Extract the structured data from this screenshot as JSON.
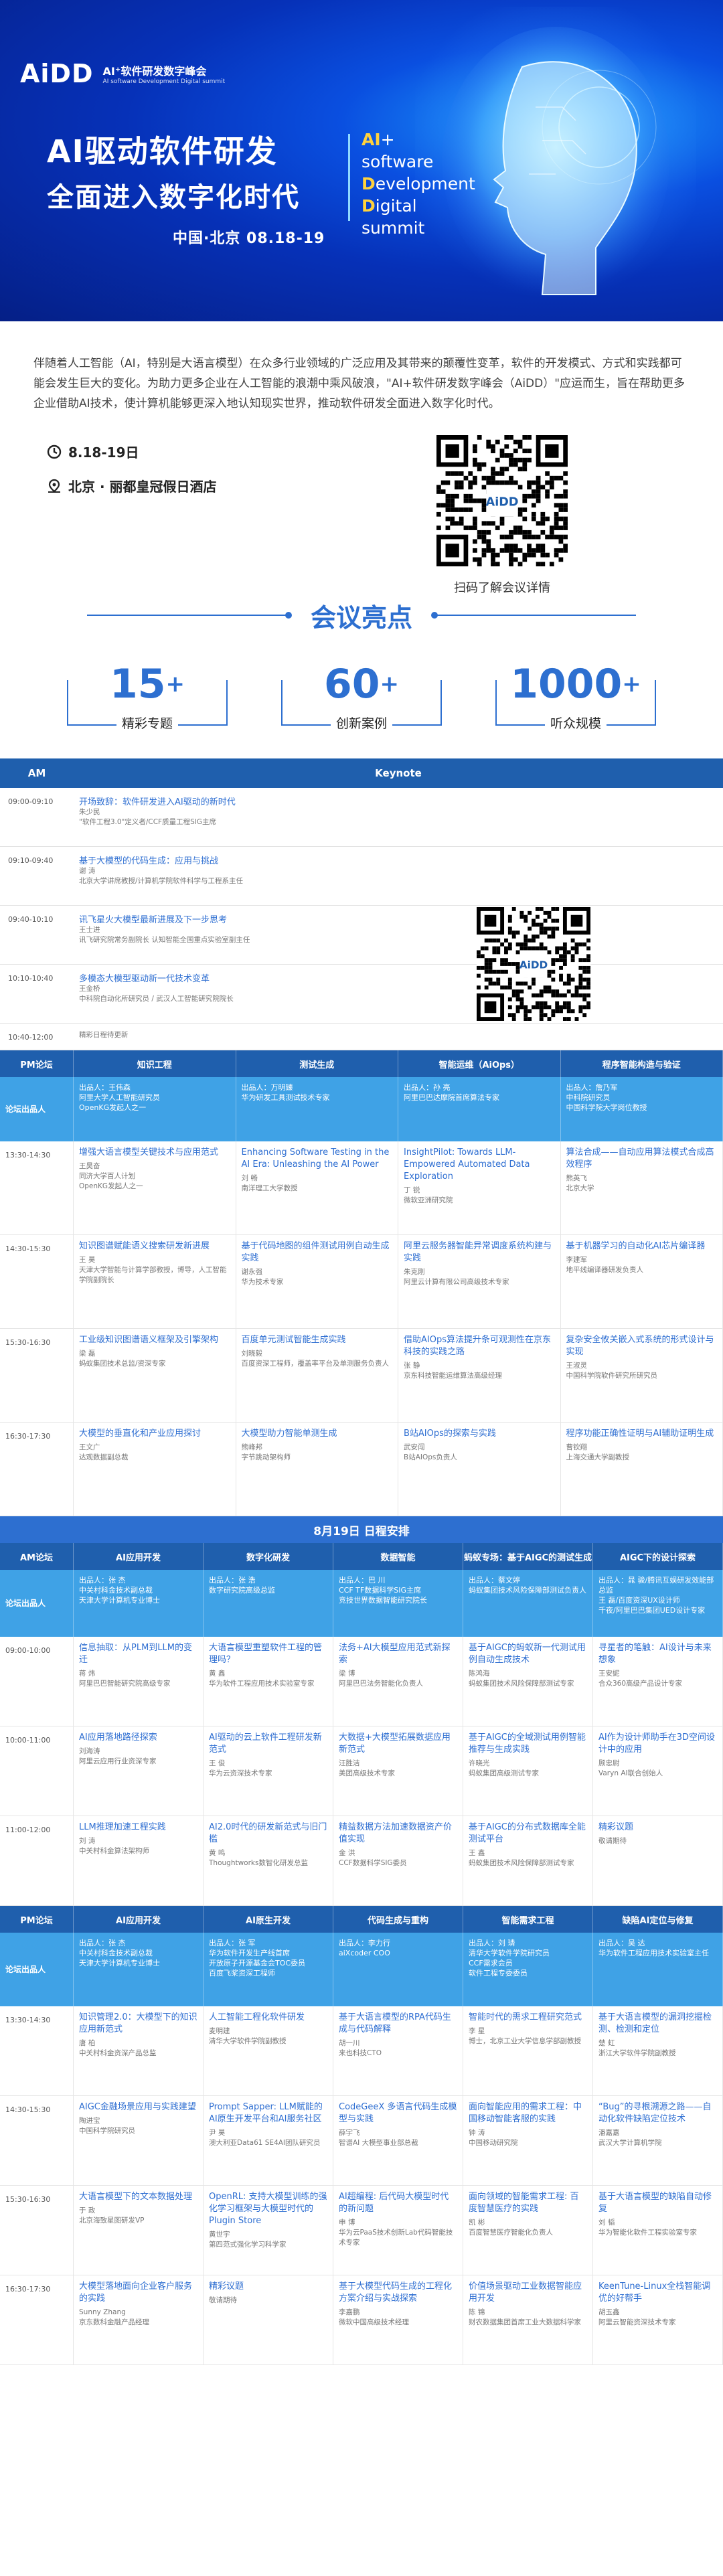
{
  "hero": {
    "logo_mark": "AiDD",
    "logo_line1": "AI⁺软件研发数字峰会",
    "logo_line2": "AI software Development Digital summit",
    "title_line1": "AI驱动软件研发",
    "title_line2": "全面进入数字化时代",
    "eng": [
      {
        "cap": "AI",
        "rest": "+"
      },
      {
        "cap": "",
        "rest": "software"
      },
      {
        "cap": "D",
        "rest": "evelopment"
      },
      {
        "cap": "D",
        "rest": "igital"
      },
      {
        "cap": "",
        "rest": "summit"
      }
    ],
    "date_line": "中国·北京 08.18-19"
  },
  "intro": {
    "text": "伴随着人工智能（AI，特别是大语言模型）在众多行业领域的广泛应用及其带来的颠覆性变革，软件的开发模式、方式和实践都可能会发生巨大的变化。为助力更多企业在人工智能的浪潮中乘风破浪，\"AI+软件研发数字峰会（AiDD）\"应运而生，旨在帮助更多企业借助AI技术，使计算机能够更深入地认知现实世界，推动软件研发全面进入数字化时代。",
    "date": "8.18-19日",
    "venue": "北京 · 丽都皇冠假日酒店",
    "qr_caption": "扫码了解会议详情"
  },
  "highlights": {
    "title": "会议亮点",
    "stats": [
      {
        "num": "15",
        "plus": "+",
        "label": "精彩专题"
      },
      {
        "num": "60",
        "plus": "+",
        "label": "创新案例"
      },
      {
        "num": "1000",
        "plus": "+",
        "label": "听众规模"
      }
    ]
  },
  "keynote": {
    "col1": "AM",
    "col2": "Keynote",
    "rows": [
      {
        "time": "09:00-09:10",
        "title": "开场致辞：软件研发进入AI驱动的新时代",
        "speaker": "朱少民",
        "desc": "\"软件工程3.0\"定义者/CCF质量工程SIG主席"
      },
      {
        "time": "09:10-09:40",
        "title": "基于大模型的代码生成：应用与挑战",
        "speaker": "谢 涛",
        "desc": "北京大学讲席教授/计算机学院软件科学与工程系主任"
      },
      {
        "time": "09:40-10:10",
        "title": "讯飞星火大模型最新进展及下一步思考",
        "speaker": "王士进",
        "desc": "讯飞研究院常务副院长 认知智能全国重点实验室副主任"
      },
      {
        "time": "10:10-10:40",
        "title": "多模态大模型驱动新一代技术变革",
        "speaker": "王金桥",
        "desc": "中科院自动化所研究员 / 武汉人工智能研究院院长"
      },
      {
        "time": "10:40-12:00",
        "title": "",
        "speaker": "",
        "desc": "精彩日程待更新"
      }
    ]
  },
  "day1pm": {
    "cols": [
      "PM论坛",
      "知识工程",
      "测试生成",
      "智能运维（AiOps）",
      "程序智能构造与验证"
    ],
    "chair_label": "论坛出品人",
    "chairs": [
      "出品人：王伟森\n阿里大学人工智能研究员\nOpenKG发起人之一",
      "出品人：万明臻\n华为研发工具测试技术专家",
      "出品人：孙 亮\n阿里巴巴达摩院首席算法专家",
      "出品人：詹乃军\n中科院研究员\n中国科学院大学岗位教授"
    ],
    "slots": [
      {
        "time": "13:30-14:30",
        "talks": [
          {
            "t": "增强大语言模型关键技术与应用范式",
            "s": "王昊奋\n同济大学百人计划\nOpenKG发起人之一"
          },
          {
            "t": "Enhancing Software Testing in the AI Era: Unleashing the AI Power",
            "s": "刘 畅\n南洋理工大学教授"
          },
          {
            "t": "InsightPilot: Towards LLM-Empowered Automated Data Exploration",
            "s": "丁 锐\n微软亚洲研究院"
          },
          {
            "t": "算法合成——自动应用算法模式合成高效程序",
            "s": "熊英飞\n北京大学"
          }
        ]
      },
      {
        "time": "14:30-15:30",
        "talks": [
          {
            "t": "知识图谱赋能语义搜索研发新进展",
            "s": "王 昊\n天津大学智能与计算学部教授，博导，人工智能学院副院长"
          },
          {
            "t": "基于代码地图的组件测试用例自动生成实践",
            "s": "谢永强\n华为技术专家"
          },
          {
            "t": "阿里云服务器智能异常调度系统构建与实践",
            "s": "朱克刚\n阿里云计算有限公司高级技术专家"
          },
          {
            "t": "基于机器学习的自动化AI芯片编译器",
            "s": "李建军\n地平线编译器研发负责人"
          }
        ]
      },
      {
        "time": "15:30-16:30",
        "talks": [
          {
            "t": "工业级知识图谱语义框架及引擎架构",
            "s": "梁 磊\n蚂蚁集团技术总监/资深专家"
          },
          {
            "t": "百度单元测试智能生成实践",
            "s": "刘晓毅\n百度资深工程师，覆盖率平台及单测服务负责人"
          },
          {
            "t": "借助AIOps算法提升条可观测性在京东科技的实践之路",
            "s": "张 静\n京东科技智能运维算法高级经理"
          },
          {
            "t": "复杂安全攸关嵌入式系统的形式设计与实现",
            "s": "王淑灵\n中国科学院软件研究所研究员"
          }
        ]
      },
      {
        "time": "16:30-17:30",
        "talks": [
          {
            "t": "大模型的垂直化和产业应用探讨",
            "s": "王文广\n达观数据副总裁"
          },
          {
            "t": "大模型助力智能单测生成",
            "s": "熊峰邦\n字节跳动架构师"
          },
          {
            "t": "B站AIOps的探索与实践",
            "s": "武安闯\nB站AIOps负责人"
          },
          {
            "t": "程序功能正确性证明与AI辅助证明生成",
            "s": "曹钦翔\n上海交通大学副教授"
          }
        ]
      }
    ]
  },
  "day2": {
    "banner": "8月19日 日程安排",
    "am_cols": [
      "AM论坛",
      "AI应用开发",
      "数字化研发",
      "数据智能",
      "蚂蚁专场：基于AIGC的测试生成",
      "AIGC下的设计探索"
    ],
    "am_chairs": [
      "出品人：张 杰\n中关村科金技术副总裁\n天津大学计算机专业博士",
      "出品人：张 浩\n数字研究院高级总监",
      "出品人：巴 川\nCCF TF数据科学SIG主席\n竞技世界数据智能研究院长",
      "出品人：蔡文婷\n蚂蚁集团技术风险保障部测试负责人",
      "出品人：晁 骏/腾讯互娱研发效能部总监\n王 磊/百度资深UX设计师\n千夜/阿里巴巴集团UED设计专家"
    ],
    "am_slots": [
      {
        "time": "09:00-10:00",
        "talks": [
          {
            "t": "信息抽取：从PLM到LLM的变迁",
            "s": "蒋 炜\n阿里巴巴智能研究院高级专家"
          },
          {
            "t": "大语言模型重塑软件工程的管理吗？",
            "s": "黄 鑫\n华为软件工程应用技术实验室专家"
          },
          {
            "t": "法务+AI大模型应用范式新探索",
            "s": "梁 博\n阿里巴巴法务智能化负责人"
          },
          {
            "t": "基于AIGC的蚂蚁新一代测试用例自动生成技术",
            "s": "陈鸿海\n蚂蚁集团技术风险保障部测试专家"
          },
          {
            "t": "寻星者的笔触：AI设计与未来想象",
            "s": "王安妮\n合众360高级产品设计专家"
          }
        ]
      },
      {
        "time": "10:00-11:00",
        "talks": [
          {
            "t": "AI应用落地路径探索",
            "s": "刘海涛\n阿里云应用行业资深专家"
          },
          {
            "t": "AI驱动的云上软件工程研发新范式",
            "s": "王 俊\n华为云资深技术专家"
          },
          {
            "t": "大数据+大模型拓展数据应用新范式",
            "s": "汪胜洁\n美团高级技术专家"
          },
          {
            "t": "基于AIGC的全域测试用例智能推荐与生成实践",
            "s": "许晓光\n蚂蚁集团高级测试专家"
          },
          {
            "t": "AI作为设计师助手在3D空间设计中的应用",
            "s": "顾忠尉\nVaryn AI联合创始人"
          }
        ]
      },
      {
        "time": "11:00-12:00",
        "talks": [
          {
            "t": "LLM推理加速工程实践",
            "s": "刘 涛\n中关村科金算法架构师"
          },
          {
            "t": "AI2.0时代的研发新范式与旧门槛",
            "s": "黄 鸣\nThoughtworks数智化研发总监"
          },
          {
            "t": "精益数据方法加速数据资产价值实现",
            "s": "金 洪\nCCF数据科学SIG委员"
          },
          {
            "t": "基于AIGC的分布式数据库全能测试平台",
            "s": "王 鑫\n蚂蚁集团技术风险保障部测试专家"
          },
          {
            "t": "精彩议题",
            "s": "敬请期待"
          }
        ]
      }
    ],
    "pm_cols": [
      "PM论坛",
      "AI应用开发",
      "AI原生开发",
      "代码生成与重构",
      "智能需求工程",
      "缺陷AI定位与修复"
    ],
    "pm_chairs": [
      "出品人：张 杰\n中关村科金技术副总裁\n天津大学计算机专业博士",
      "出品人：张 军\n华为软件开发生产线首席\n开放原子开源基金会TOC委员\n百度飞桨资深工程师",
      "出品人：李力行\naiXcoder COO",
      "出品人：刘 璘\n清华大学软件学院研究员\nCCF需求会员\n软件工程专委委员",
      "出品人：吴 达\n华为软件工程应用技术实验室主任"
    ],
    "pm_slots": [
      {
        "time": "13:30-14:30",
        "talks": [
          {
            "t": "知识管理2.0：大模型下的知识应用新范式",
            "s": "唐 柏\n中关村科金资深产品总监"
          },
          {
            "t": "人工智能工程化软件研发",
            "s": "麦明建\n清华大学软件学院副教授"
          },
          {
            "t": "基于大语言模型的RPA代码生成与代码解释",
            "s": "胡一川\n来也科技CTO"
          },
          {
            "t": "智能时代的需求工程研究范式",
            "s": "李 星\n博士，北京工业大学信息学部副教授"
          },
          {
            "t": "基于大语言模型的漏洞挖掘检测、检测和定位",
            "s": "楚 虹\n浙江大学软件学院副教授"
          }
        ]
      },
      {
        "time": "14:30-15:30",
        "talks": [
          {
            "t": "AIGC金融场景应用与实践建望",
            "s": "陶进宝\n中国科学院研究员"
          },
          {
            "t": "Prompt Sapper: LLM赋能的AI原生开发平台和AI服务社区",
            "s": "尹 昊\n澳大利亚Data61 SE4AI团队研究员"
          },
          {
            "t": "CodeGeeX 多语言代码生成模型与实践",
            "s": "薛宇飞\n智谱AI 大模型事业部总裁"
          },
          {
            "t": "面向智能应用的需求工程：中国移动智能客服的实践",
            "s": "钟 涛\n中国移动研究院"
          },
          {
            "t": "“Bug”的寻根溯源之路——自动化软件缺陷定位技术",
            "s": "潘嘉嘉\n武汉大学计算机学院"
          }
        ]
      },
      {
        "time": "15:30-16:30",
        "talks": [
          {
            "t": "大语言模型下的文本数据处理",
            "s": "于 政\n北京海致星图研发VP"
          },
          {
            "t": "OpenRL: 支持大模型训练的强化学习框架与大模型时代的Plugin Store",
            "s": "黄世宇\n第四范式强化学习科学家"
          },
          {
            "t": "AI超编程: 后代码大模型时代的新问题",
            "s": "申 博\n华为云PaaS技术创新Lab代码智能技术专家"
          },
          {
            "t": "面向领域的智能需求工程: 百度智慧医疗的实践",
            "s": "凯 彬\n百度智慧医疗智能化负责人"
          },
          {
            "t": "基于大语言模型的缺陷自动修复",
            "s": "刘 韬\n华为智能化软件工程实验室专家"
          }
        ]
      },
      {
        "time": "16:30-17:30",
        "talks": [
          {
            "t": "大模型落地面向企业客户服务的实践",
            "s": "Sunny Zhang\n京东数科金融产品经理"
          },
          {
            "t": "精彩议题",
            "s": "敬请期待"
          },
          {
            "t": "基于大模型代码生成的工程化方案介绍与实战探索",
            "s": "李嘉鹏\n微软中国高级技术经理"
          },
          {
            "t": "价值场景驱动工业数据智能应用开发",
            "s": "陈 锦\n财农数据集团首席工业大数据科学家"
          },
          {
            "t": "KeenTune-Linux全栈智能调优的好帮手",
            "s": "胡玉鑫\n阿里云智能资深技术专家"
          }
        ]
      }
    ]
  },
  "colors": {
    "primary": "#1f5fad",
    "accent": "#2d6fd0",
    "chair": "#3fa2e6",
    "link": "#2f6fd2",
    "highlight": "#ffd23d"
  },
  "icons": {
    "clock": "clock-icon",
    "location": "location-icon",
    "qr": "qr-code-icon"
  }
}
